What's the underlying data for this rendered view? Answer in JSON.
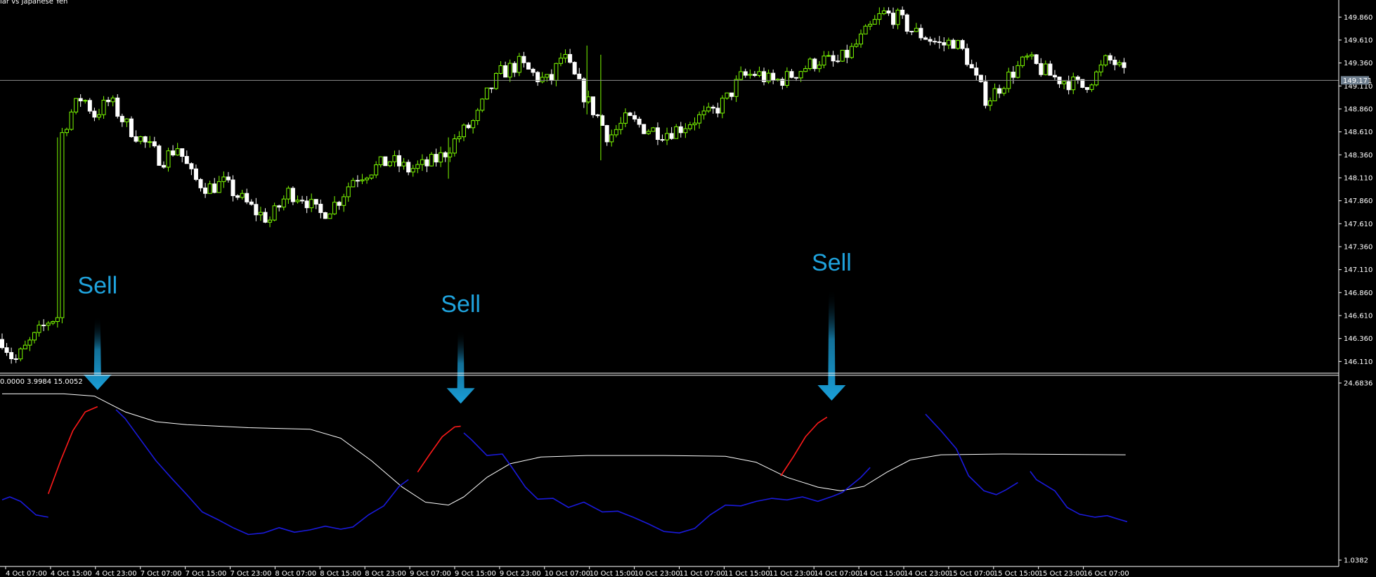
{
  "chart_data": [
    {
      "type": "candlestick",
      "title": "lar vs Japanese Yen",
      "y_ticks": [
        "149.860",
        "149.610",
        "149.360",
        "149.110",
        "148.860",
        "148.610",
        "148.360",
        "148.110",
        "147.860",
        "147.610",
        "147.360",
        "147.110",
        "146.860",
        "146.610",
        "146.360",
        "146.110"
      ],
      "ylim": [
        145.99,
        150.0
      ],
      "current_price": "149.171",
      "current_price_value": 149.171,
      "colors": {
        "up": "#7cfc00",
        "down": "#ffffff",
        "grid_line": "#8c8c8c",
        "badge": "#6f7f8f"
      },
      "seed": 7,
      "anchors": [
        [
          0,
          146.35
        ],
        [
          8,
          146.11
        ],
        [
          20,
          146.35
        ],
        [
          30,
          146.55
        ],
        [
          36,
          146.6
        ],
        [
          38,
          148.55
        ],
        [
          44,
          148.8
        ],
        [
          52,
          149.0
        ],
        [
          60,
          148.8
        ],
        [
          70,
          148.95
        ],
        [
          80,
          148.7
        ],
        [
          92,
          148.5
        ],
        [
          104,
          148.3
        ],
        [
          114,
          148.45
        ],
        [
          124,
          148.1
        ],
        [
          134,
          148.0
        ],
        [
          144,
          148.05
        ],
        [
          154,
          147.9
        ],
        [
          164,
          147.75
        ],
        [
          174,
          147.65
        ],
        [
          186,
          147.95
        ],
        [
          196,
          147.9
        ],
        [
          206,
          147.7
        ],
        [
          218,
          147.85
        ],
        [
          228,
          148.1
        ],
        [
          240,
          148.2
        ],
        [
          252,
          148.3
        ],
        [
          264,
          148.2
        ],
        [
          276,
          148.25
        ],
        [
          286,
          148.35
        ],
        [
          296,
          148.55
        ],
        [
          308,
          148.75
        ],
        [
          316,
          149.05
        ],
        [
          324,
          149.25
        ],
        [
          336,
          149.35
        ],
        [
          348,
          149.2
        ],
        [
          356,
          149.15
        ],
        [
          364,
          149.45
        ],
        [
          372,
          149.2
        ],
        [
          380,
          148.95
        ],
        [
          388,
          148.75
        ],
        [
          394,
          148.55
        ],
        [
          406,
          148.75
        ],
        [
          418,
          148.65
        ],
        [
          430,
          148.6
        ],
        [
          440,
          148.65
        ],
        [
          450,
          148.75
        ],
        [
          460,
          148.8
        ],
        [
          470,
          148.95
        ],
        [
          480,
          149.2
        ],
        [
          490,
          149.25
        ],
        [
          500,
          149.15
        ],
        [
          510,
          149.2
        ],
        [
          520,
          149.3
        ],
        [
          532,
          149.4
        ],
        [
          542,
          149.35
        ],
        [
          552,
          149.5
        ],
        [
          562,
          149.7
        ],
        [
          572,
          149.9
        ],
        [
          582,
          149.85
        ],
        [
          592,
          149.7
        ],
        [
          600,
          149.65
        ],
        [
          610,
          149.55
        ],
        [
          618,
          149.6
        ],
        [
          626,
          149.45
        ],
        [
          632,
          149.2
        ],
        [
          640,
          148.95
        ],
        [
          648,
          149.1
        ],
        [
          656,
          149.25
        ],
        [
          666,
          149.4
        ],
        [
          674,
          149.3
        ],
        [
          684,
          149.2
        ],
        [
          694,
          149.15
        ],
        [
          702,
          149.1
        ],
        [
          712,
          149.25
        ],
        [
          718,
          149.4
        ],
        [
          724,
          149.35
        ],
        [
          730,
          149.2
        ]
      ],
      "total_bars": 731
    },
    {
      "type": "line",
      "title": "0.0000 3.9984 15.0052",
      "y_ticks": [
        "24.6836",
        "1.0382"
      ],
      "ylim": [
        1.0382,
        24.6836
      ],
      "series": [
        {
          "name": "",
          "color": "#ffffff",
          "values": [
            [
              0,
              23.9
            ],
            [
              40,
              23.9
            ],
            [
              60,
              23.6
            ],
            [
              80,
              21.5
            ],
            [
              100,
              20.2
            ],
            [
              120,
              19.8
            ],
            [
              160,
              19.4
            ],
            [
              200,
              19.2
            ],
            [
              220,
              18.0
            ],
            [
              240,
              15.0
            ],
            [
              260,
              11.5
            ],
            [
              275,
              9.5
            ],
            [
              290,
              9.1
            ],
            [
              300,
              10.2
            ],
            [
              315,
              12.8
            ],
            [
              330,
              14.6
            ],
            [
              350,
              15.5
            ],
            [
              380,
              15.7
            ],
            [
              430,
              15.7
            ],
            [
              470,
              15.6
            ],
            [
              490,
              14.8
            ],
            [
              510,
              12.8
            ],
            [
              530,
              11.5
            ],
            [
              545,
              11.0
            ],
            [
              560,
              11.6
            ],
            [
              575,
              13.5
            ],
            [
              590,
              15.1
            ],
            [
              610,
              15.8
            ],
            [
              650,
              15.9
            ],
            [
              730,
              15.8
            ]
          ]
        },
        {
          "name": "",
          "color": "#1a1adc",
          "values": [
            [
              0,
              9.8
            ],
            [
              5,
              10.2
            ],
            [
              12,
              9.6
            ],
            [
              22,
              7.8
            ],
            [
              30,
              7.5
            ],
            null,
            [
              74,
              21.8
            ],
            [
              80,
              20.6
            ],
            [
              90,
              17.8
            ],
            [
              100,
              15.0
            ],
            [
              110,
              12.7
            ],
            [
              120,
              10.5
            ],
            [
              130,
              8.2
            ],
            [
              140,
              7.2
            ],
            [
              150,
              6.1
            ],
            [
              160,
              5.2
            ],
            [
              170,
              5.4
            ],
            [
              180,
              6.1
            ],
            [
              190,
              5.5
            ],
            [
              200,
              5.8
            ],
            [
              210,
              6.3
            ],
            [
              220,
              5.9
            ],
            [
              228,
              6.2
            ],
            [
              238,
              7.8
            ],
            [
              248,
              9.0
            ],
            [
              258,
              11.6
            ],
            [
              264,
              12.5
            ],
            null,
            [
              300,
              18.7
            ],
            [
              305,
              17.8
            ],
            [
              315,
              15.7
            ],
            [
              325,
              15.9
            ],
            [
              330,
              14.5
            ],
            [
              340,
              11.5
            ],
            [
              348,
              9.9
            ],
            [
              358,
              10.0
            ],
            [
              368,
              8.8
            ],
            [
              378,
              9.5
            ],
            [
              390,
              8.2
            ],
            [
              400,
              8.3
            ],
            [
              410,
              7.5
            ],
            [
              420,
              6.6
            ],
            [
              430,
              5.6
            ],
            [
              440,
              5.4
            ],
            [
              450,
              6.0
            ],
            [
              460,
              7.8
            ],
            [
              470,
              9.1
            ],
            [
              480,
              9.0
            ],
            [
              490,
              9.6
            ],
            [
              500,
              10.0
            ],
            [
              510,
              9.8
            ],
            [
              520,
              10.2
            ],
            [
              530,
              9.6
            ],
            [
              540,
              10.3
            ],
            [
              546,
              10.8
            ],
            [
              558,
              12.8
            ],
            [
              564,
              14.1
            ],
            null,
            [
              600,
              21.2
            ],
            [
              610,
              19.0
            ],
            [
              620,
              16.6
            ],
            [
              628,
              13.0
            ],
            [
              638,
              11.0
            ],
            [
              646,
              10.5
            ],
            [
              652,
              11.1
            ],
            [
              660,
              12.1
            ],
            null,
            [
              668,
              13.6
            ],
            [
              672,
              12.5
            ],
            [
              684,
              11.0
            ],
            [
              692,
              8.8
            ],
            [
              700,
              7.9
            ],
            [
              710,
              7.5
            ],
            [
              718,
              7.7
            ],
            [
              726,
              7.2
            ],
            [
              731,
              6.9
            ]
          ]
        },
        {
          "name": "",
          "color": "#ff1a1a",
          "values": [
            [
              30,
              10.6
            ],
            [
              38,
              15.0
            ],
            [
              46,
              19.0
            ],
            [
              54,
              21.5
            ],
            [
              62,
              22.2
            ],
            null,
            [
              270,
              13.5
            ],
            [
              278,
              15.9
            ],
            [
              286,
              18.2
            ],
            [
              294,
              19.5
            ],
            [
              298,
              19.6
            ],
            null,
            [
              506,
              13.0
            ],
            [
              514,
              15.5
            ],
            [
              522,
              18.2
            ],
            [
              530,
              20.0
            ],
            [
              536,
              20.8
            ]
          ]
        }
      ]
    }
  ],
  "x_ticks": [
    "4 Oct 07:00",
    "4 Oct 15:00",
    "4 Oct 23:00",
    "7 Oct 07:00",
    "7 Oct 15:00",
    "7 Oct 23:00",
    "8 Oct 07:00",
    "8 Oct 15:00",
    "8 Oct 23:00",
    "9 Oct 07:00",
    "9 Oct 15:00",
    "9 Oct 23:00",
    "10 Oct 07:00",
    "10 Oct 15:00",
    "10 Oct 23:00",
    "11 Oct 07:00",
    "11 Oct 15:00",
    "11 Oct 23:00",
    "14 Oct 07:00",
    "14 Oct 15:00",
    "14 Oct 23:00",
    "15 Oct 07:00",
    "15 Oct 15:00",
    "15 Oct 23:00",
    "16 Oct 07:00"
  ],
  "annotations": [
    {
      "text": "Sell",
      "bar": 62,
      "label_price": 146.85,
      "arrow_top_price": 146.6,
      "tip_value": 24.4
    },
    {
      "text": "Sell",
      "bar": 298,
      "label_price": 146.65,
      "arrow_top_price": 146.45,
      "tip_value": 22.6
    },
    {
      "text": "Sell",
      "bar": 539,
      "label_price": 147.1,
      "arrow_top_price": 146.9,
      "tip_value": 23.0
    }
  ],
  "arrow_color": "#1a9fd8"
}
